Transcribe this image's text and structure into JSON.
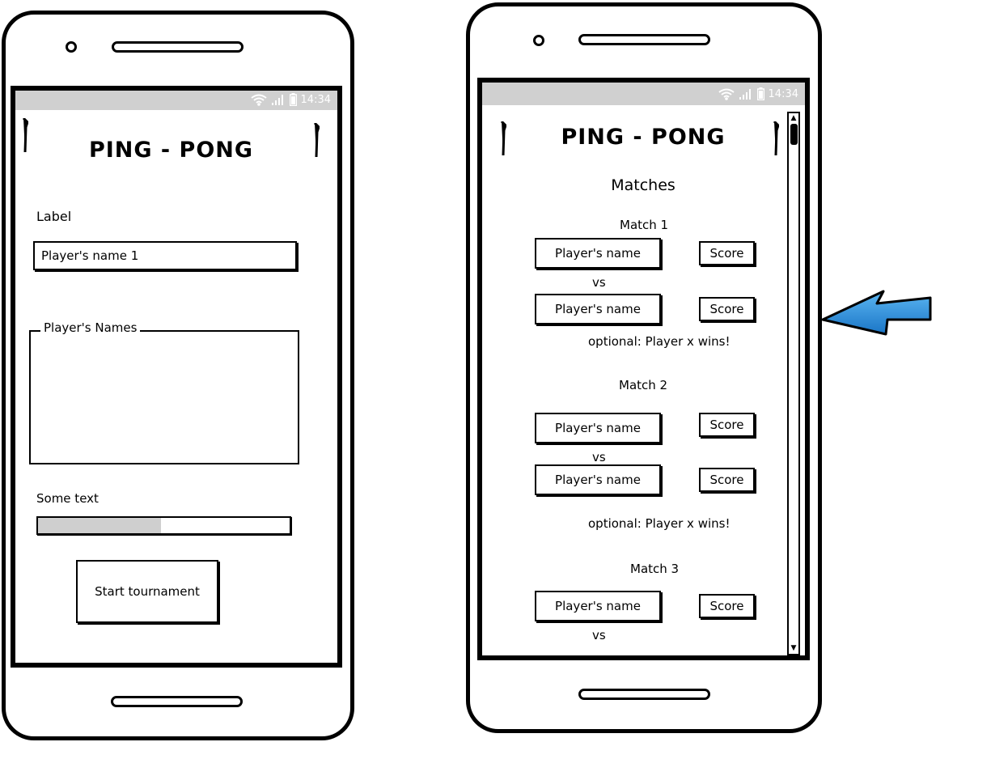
{
  "status": {
    "time": "14:34"
  },
  "screen1": {
    "title": "PING - PONG",
    "label": "Label",
    "name_input": {
      "value": "Player's name 1",
      "placeholder": ""
    },
    "names_group": {
      "legend": "Player's Names"
    },
    "progress": {
      "label": "Some text",
      "value_percent": 49
    },
    "start_button": "Start tournament"
  },
  "screen2": {
    "title": "PING - PONG",
    "heading": "Matches",
    "matches": [
      {
        "title": "Match 1",
        "player1": "Player's name",
        "score1": "Score",
        "vs": "vs",
        "player2": "Player's name",
        "score2": "Score",
        "result": "optional: Player x wins!"
      },
      {
        "title": "Match 2",
        "player1": "Player's name",
        "score1": "Score",
        "vs": "vs",
        "player2": "Player's name",
        "score2": "Score",
        "result": "optional: Player x wins!"
      },
      {
        "title": "Match 3",
        "player1": "Player's name",
        "score1": "Score",
        "vs": "vs"
      }
    ]
  },
  "icons": [
    "wifi-icon",
    "signal-icon",
    "battery-icon",
    "pin-icon",
    "arrow-icon",
    "scroll-up-icon",
    "scroll-down-icon"
  ],
  "colors": {
    "status_bar": "#d0d0d0",
    "progress_fill": "#cfcfcf",
    "arrow": "#1f86d8"
  }
}
